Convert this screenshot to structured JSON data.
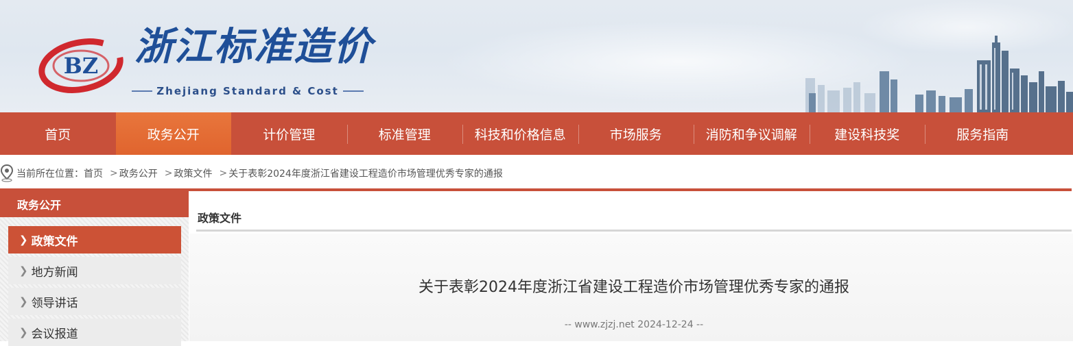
{
  "header": {
    "logo_badge": "BZ",
    "site_title": "浙江标准造价",
    "site_subtitle": "Zhejiang Standard & Cost"
  },
  "nav": {
    "items": [
      {
        "label": "首页"
      },
      {
        "label": "政务公开",
        "active": true
      },
      {
        "label": "计价管理"
      },
      {
        "label": "标准管理"
      },
      {
        "label": "科技和价格信息"
      },
      {
        "label": "市场服务"
      },
      {
        "label": "消防和争议调解"
      },
      {
        "label": "建设科技奖"
      },
      {
        "label": "服务指南"
      }
    ]
  },
  "breadcrumb": {
    "prefix": "当前所在位置：",
    "items": [
      "首页",
      "政务公开",
      "政策文件",
      "关于表彰2024年度浙江省建设工程造价市场管理优秀专家的通报"
    ],
    "separator": ">"
  },
  "sidebar": {
    "heading": "政务公开",
    "items": [
      {
        "label": "政策文件",
        "active": true
      },
      {
        "label": "地方新闻"
      },
      {
        "label": "领导讲话"
      },
      {
        "label": "会议报道"
      }
    ]
  },
  "content": {
    "section_title": "政策文件",
    "article_title": "关于表彰2024年度浙江省建设工程造价市场管理优秀专家的通报",
    "article_meta": "-- www.zjzj.net 2024-12-24 --"
  },
  "colors": {
    "nav_bg": "#c8503a",
    "nav_active": "#e36a32",
    "brand_blue": "#1f4f98",
    "logo_red": "#d0282e"
  },
  "icons": {
    "chevron": "chevron-right-icon",
    "location": "location-pin-icon"
  }
}
